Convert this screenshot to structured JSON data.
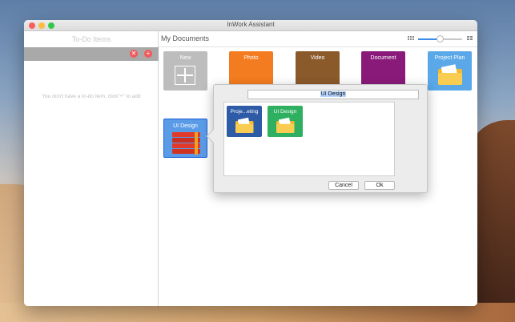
{
  "window": {
    "title": "InWork Assistant"
  },
  "sidebar": {
    "title": "To-Do Items",
    "empty_message": "You don't have a to-do item,  click\"+\" to add",
    "trash_glyph": "✕",
    "add_glyph": "+"
  },
  "main": {
    "title": "My Documents",
    "zoom_level": 0.5,
    "tiles": [
      {
        "label": "New",
        "color": "#bdbdbd"
      },
      {
        "label": "Photo",
        "color": "#f47c20"
      },
      {
        "label": "Video",
        "color": "#8b5a2b"
      },
      {
        "label": "Document",
        "color": "#8a1a7a"
      },
      {
        "label": "Project Plan",
        "color": "#5aa8e8"
      },
      {
        "label": "UI Design",
        "color": "#5a9be8"
      }
    ]
  },
  "popover": {
    "name_value": "UI Design",
    "items": [
      {
        "label": "Proje...eting",
        "color": "#2e5ba6"
      },
      {
        "label": "UI Design",
        "color": "#2fb060"
      }
    ],
    "cancel_label": "Cancel",
    "ok_label": "Ok"
  }
}
